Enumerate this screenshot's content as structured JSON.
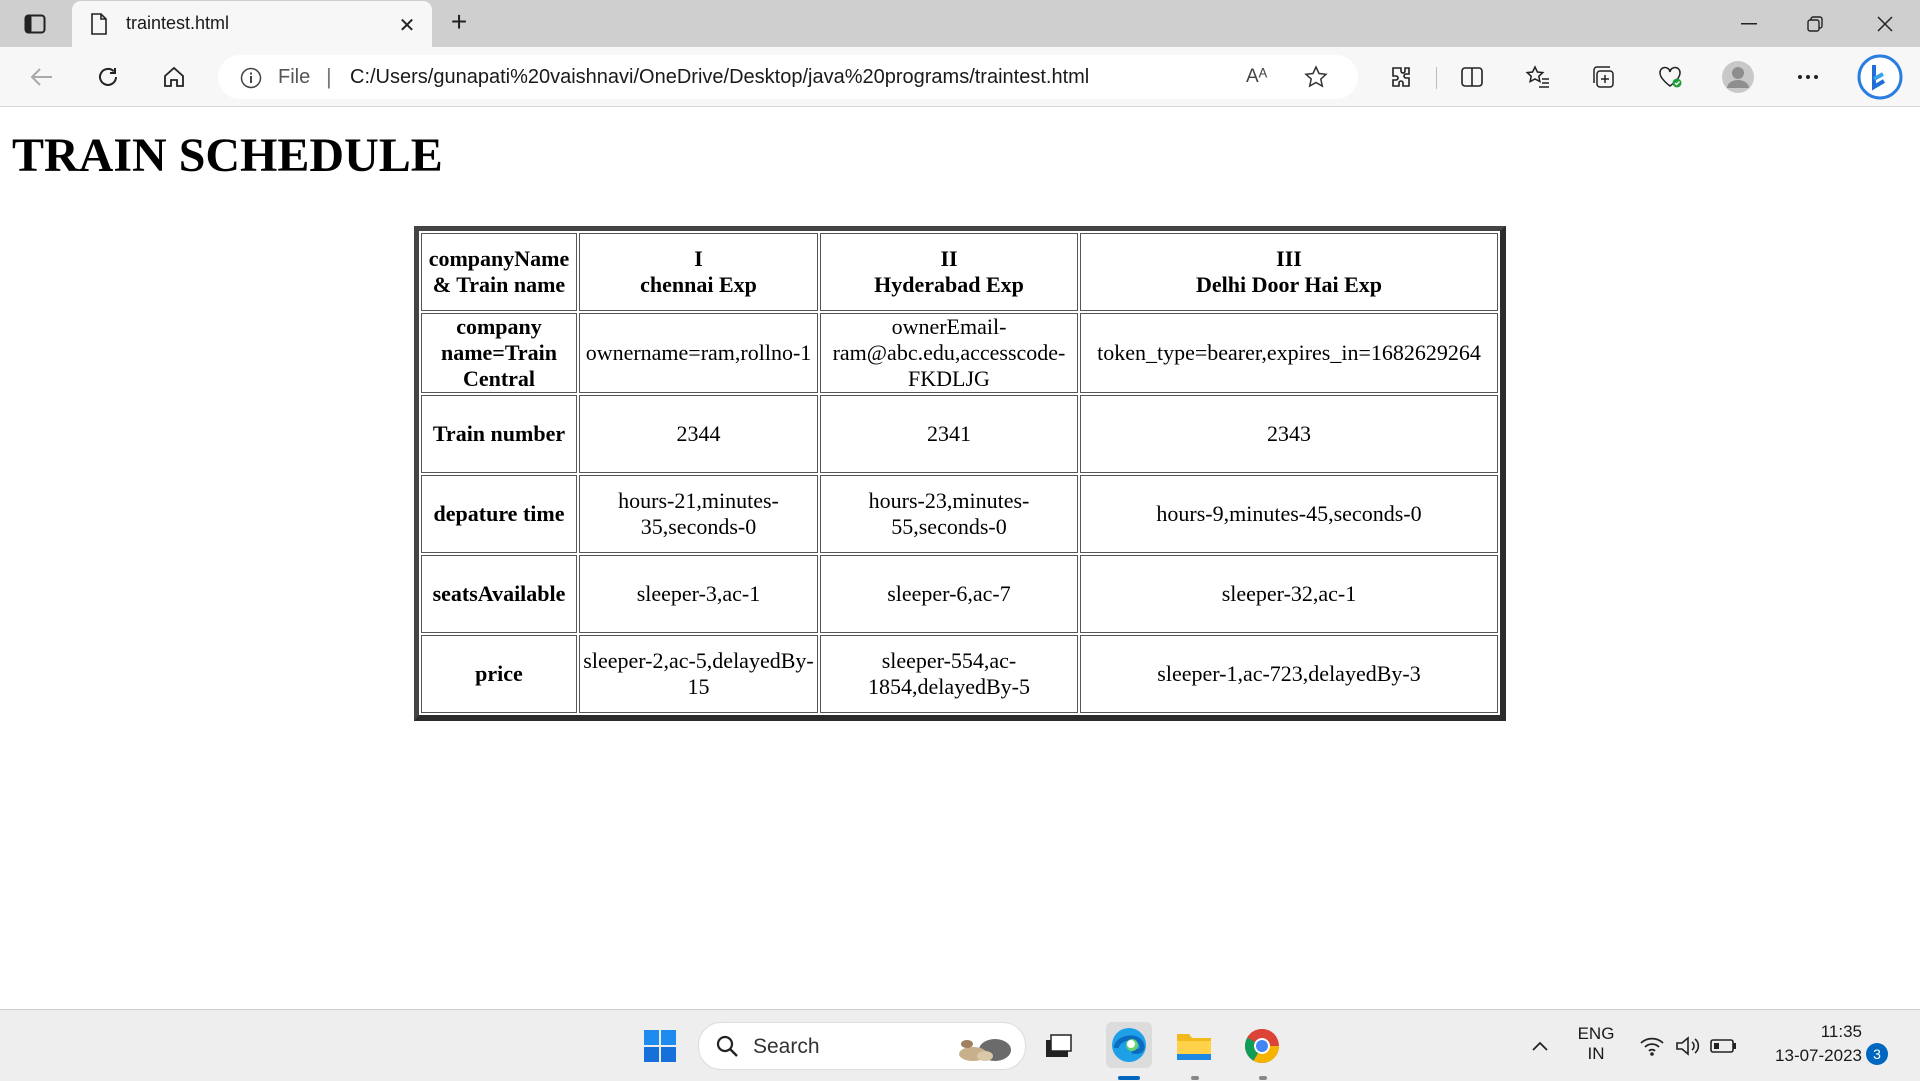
{
  "browser": {
    "tab": {
      "title": "traintest.html",
      "close": "✕"
    },
    "new_tab": "+",
    "address": {
      "scheme": "File",
      "separator": "|",
      "url": "C:/Users/gunapati%20vaishnavi/OneDrive/Desktop/java%20programs/traintest.html",
      "read_aloud": "Aᴬ"
    }
  },
  "page": {
    "title": "TRAIN SCHEDULE",
    "table": {
      "header": [
        {
          "line1": "companyName",
          "line2": "& Train name"
        },
        {
          "line1": "I",
          "line2": "chennai Exp"
        },
        {
          "line1": "II",
          "line2": "Hyderabad Exp"
        },
        {
          "line1": "III",
          "line2": "Delhi Door Hai Exp"
        }
      ],
      "rows": [
        {
          "label": "company name=Train Central",
          "cells": [
            "ownername=ram,rollno-1",
            "ownerEmail-ram@abc.edu,accesscode-FKDLJG",
            "token_type=bearer,expires_in=1682629264"
          ]
        },
        {
          "label": "Train number",
          "cells": [
            "2344",
            "2341",
            "2343"
          ]
        },
        {
          "label": "depature time",
          "cells": [
            "hours-21,minutes-35,seconds-0",
            "hours-23,minutes-55,seconds-0",
            "hours-9,minutes-45,seconds-0"
          ]
        },
        {
          "label": "seatsAvailable",
          "cells": [
            "sleeper-3,ac-1",
            "sleeper-6,ac-7",
            "sleeper-32,ac-1"
          ]
        },
        {
          "label": "price",
          "cells": [
            "sleeper-2,ac-5,delayedBy-15",
            "sleeper-554,ac-1854,delayedBy-5",
            "sleeper-1,ac-723,delayedBy-3"
          ]
        }
      ]
    }
  },
  "taskbar": {
    "search_label": "Search",
    "language": {
      "line1": "ENG",
      "line2": "IN"
    },
    "time": "11:35",
    "date": "13-07-2023",
    "notification_count": "3"
  }
}
